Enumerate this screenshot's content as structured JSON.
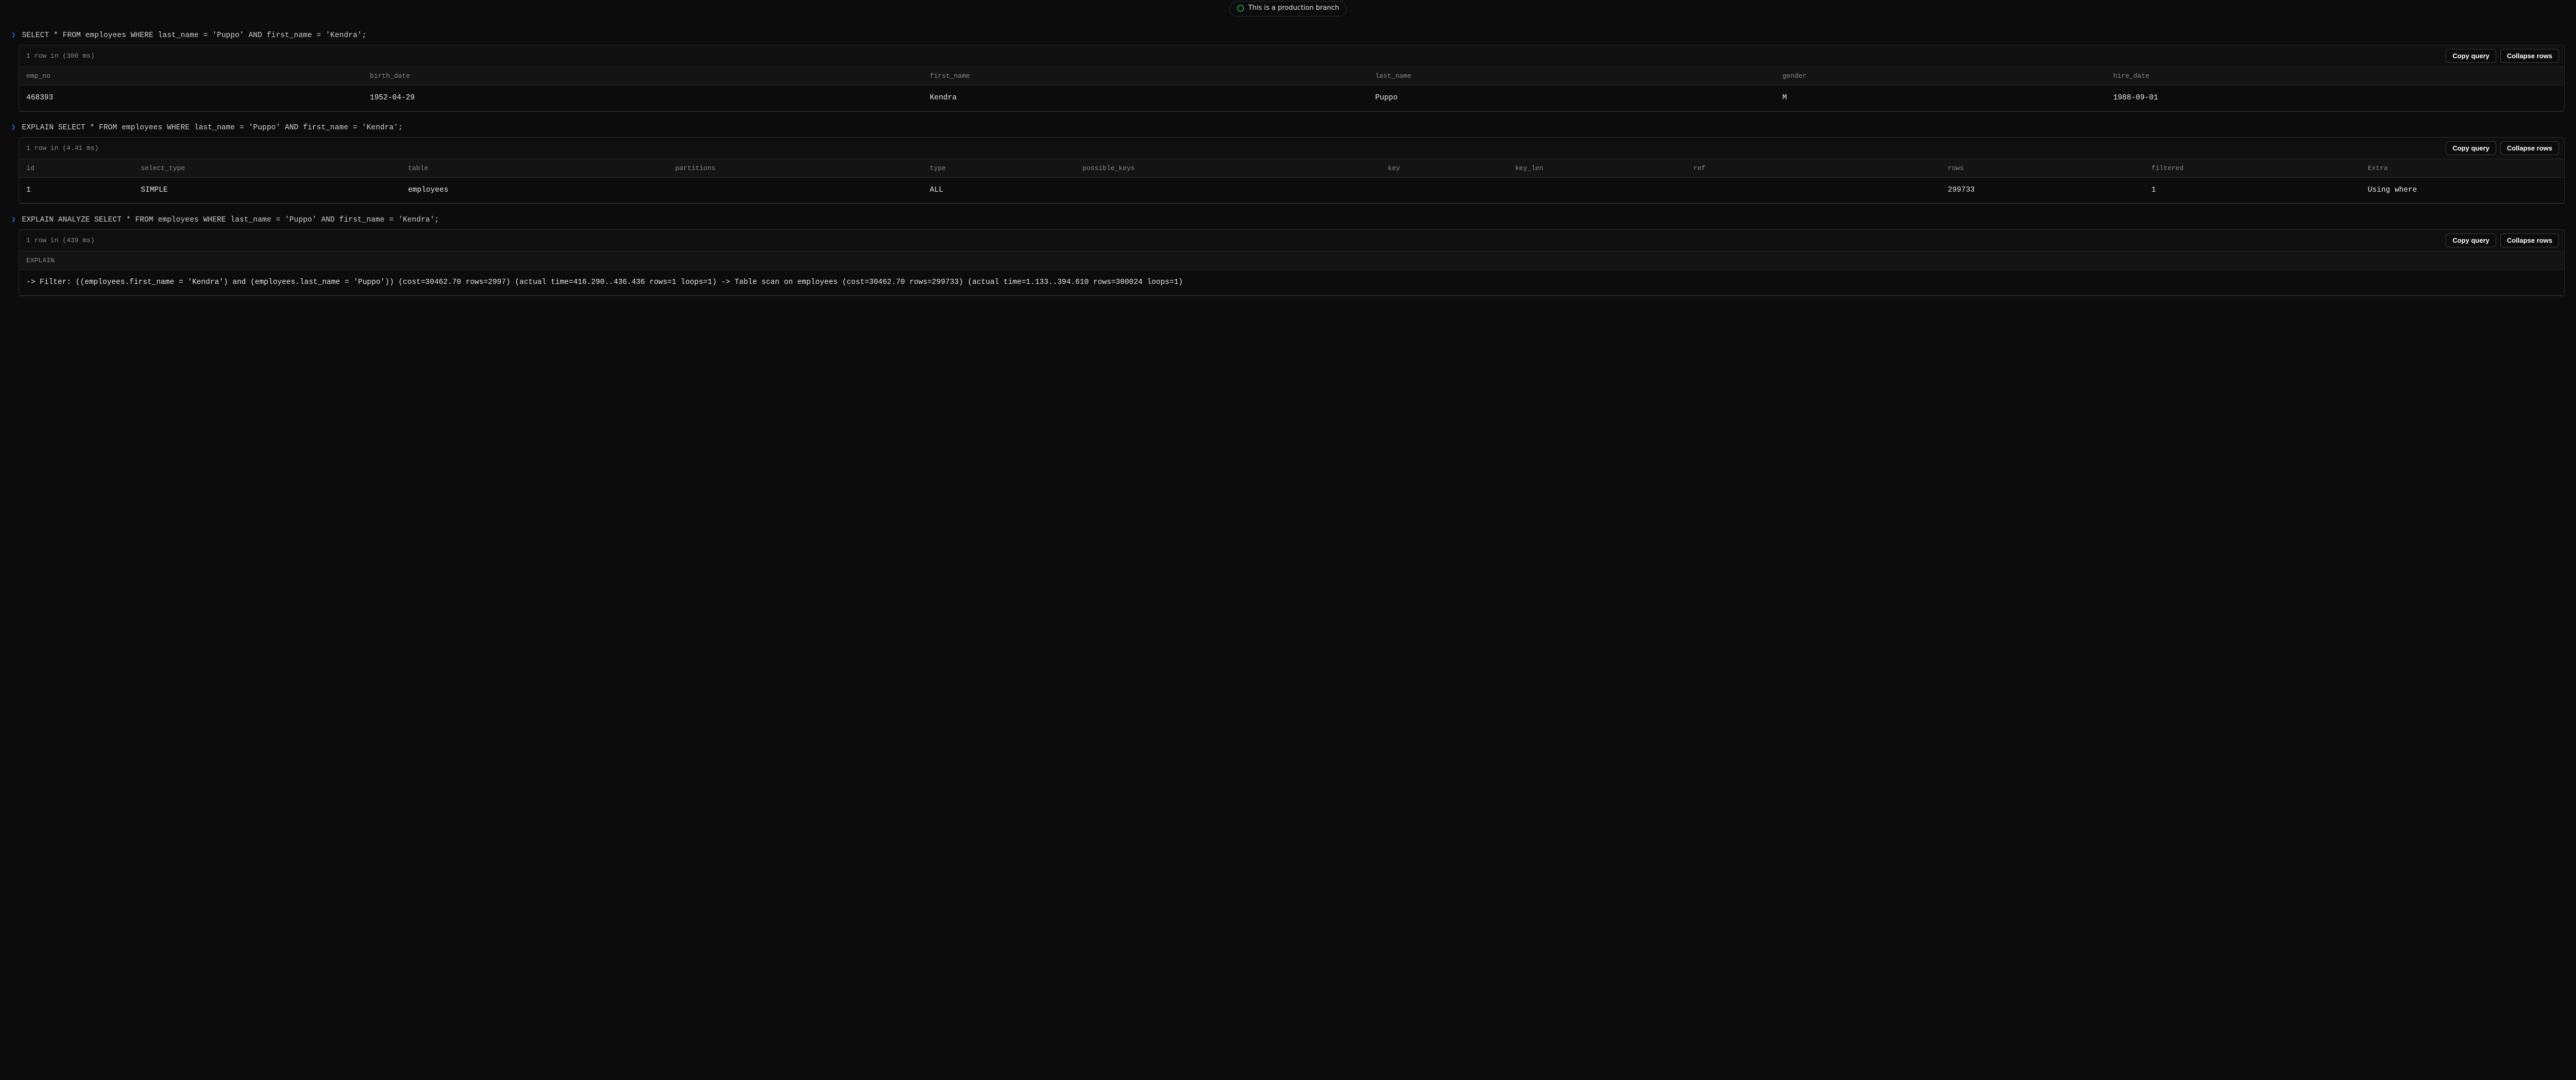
{
  "badge": {
    "text": "This is a production branch"
  },
  "buttons": {
    "copy": "Copy query",
    "collapse": "Collapse rows"
  },
  "blocks": [
    {
      "query": "SELECT * FROM employees WHERE last_name = 'Puppo' AND first_name = 'Kendra';",
      "rows_info": "1 row in (300 ms)",
      "col_widths": [
        "13.5%",
        "22%",
        "17.5%",
        "16%",
        "13%",
        "18%"
      ],
      "columns": [
        "emp_no",
        "birth_date",
        "first_name",
        "last_name",
        "gender",
        "hire_date"
      ],
      "rows": [
        [
          "468393",
          "1952-04-29",
          "Kendra",
          "Puppo",
          "M",
          "1988-09-01"
        ]
      ]
    },
    {
      "query": "EXPLAIN SELECT * FROM employees WHERE last_name = 'Puppo' AND first_name = 'Kendra';",
      "rows_info": "1 row in (4.41 ms)",
      "col_widths": [
        "4.5%",
        "10.5%",
        "10.5%",
        "10%",
        "6%",
        "12%",
        "5%",
        "7%",
        "10%",
        "8%",
        "8.5%",
        "8%"
      ],
      "columns": [
        "id",
        "select_type",
        "table",
        "partitions",
        "type",
        "possible_keys",
        "key",
        "key_len",
        "ref",
        "rows",
        "filtered",
        "Extra"
      ],
      "rows": [
        [
          "1",
          "SIMPLE",
          "employees",
          "",
          "ALL",
          "",
          "",
          "",
          "",
          "299733",
          "1",
          "Using where"
        ]
      ]
    },
    {
      "query": "EXPLAIN ANALYZE SELECT * FROM employees WHERE last_name = 'Puppo' AND first_name = 'Kendra';",
      "rows_info": "1 row in (439 ms)",
      "col_widths": [
        "100%"
      ],
      "columns": [
        "EXPLAIN"
      ],
      "rows": [
        [
          "-> Filter: ((employees.first_name = 'Kendra') and (employees.last_name = 'Puppo')) (cost=30462.70 rows=2997) (actual time=416.290..436.436 rows=1 loops=1) -> Table scan on employees (cost=30462.70 rows=299733) (actual time=1.133..394.610 rows=300024 loops=1)"
        ]
      ]
    }
  ]
}
